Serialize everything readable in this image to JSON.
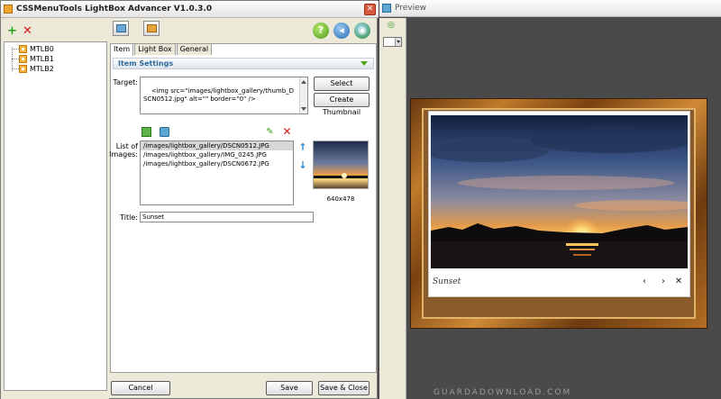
{
  "window": {
    "title": "CSSMenuTools LightBox Advancer V1.0.3.0",
    "close_label": "✕"
  },
  "toolbar": {
    "add_label": "+",
    "delete_label": "✕"
  },
  "tree": {
    "items": [
      {
        "label": "MTLB0"
      },
      {
        "label": "MTLB1"
      },
      {
        "label": "MTLB2"
      }
    ]
  },
  "tabs": [
    {
      "label": "Item",
      "active": true
    },
    {
      "label": "Light Box",
      "active": false
    },
    {
      "label": "General",
      "active": false
    }
  ],
  "section": {
    "title": "Item Settings"
  },
  "target": {
    "label": "Target:",
    "value": "<img src=\"images/lightbox_gallery/thumb_DSCN0512.jpg\" alt=\"\" border=\"0\" />",
    "select_button": "Select Thumbnail",
    "create_button": "Create Thumbnail"
  },
  "images": {
    "label_line1": "List of",
    "label_line2": "Images:",
    "items": [
      {
        "path": "/images/lightbox_gallery/DSCN0512.JPG",
        "selected": true
      },
      {
        "path": "/images/lightbox_gallery/IMG_0245.JPG",
        "selected": false
      },
      {
        "path": "/images/lightbox_gallery/DSCN0672.JPG",
        "selected": false
      }
    ],
    "thumb_size": "640x478"
  },
  "title_field": {
    "label": "Title:",
    "value": "Sunset"
  },
  "buttons": {
    "cancel": "Cancel",
    "save": "Save",
    "save_close": "Save & Close"
  },
  "preview": {
    "title": "Preview",
    "caption": "Sunset",
    "prev": "‹",
    "next": "›",
    "close": "✕",
    "watermark": "GUARDADOWNLOAD.COM"
  },
  "icons": {
    "help": "help-icon",
    "back": "back-icon",
    "world": "globe-icon",
    "up": "arrow-up-icon",
    "down": "arrow-down-icon"
  }
}
